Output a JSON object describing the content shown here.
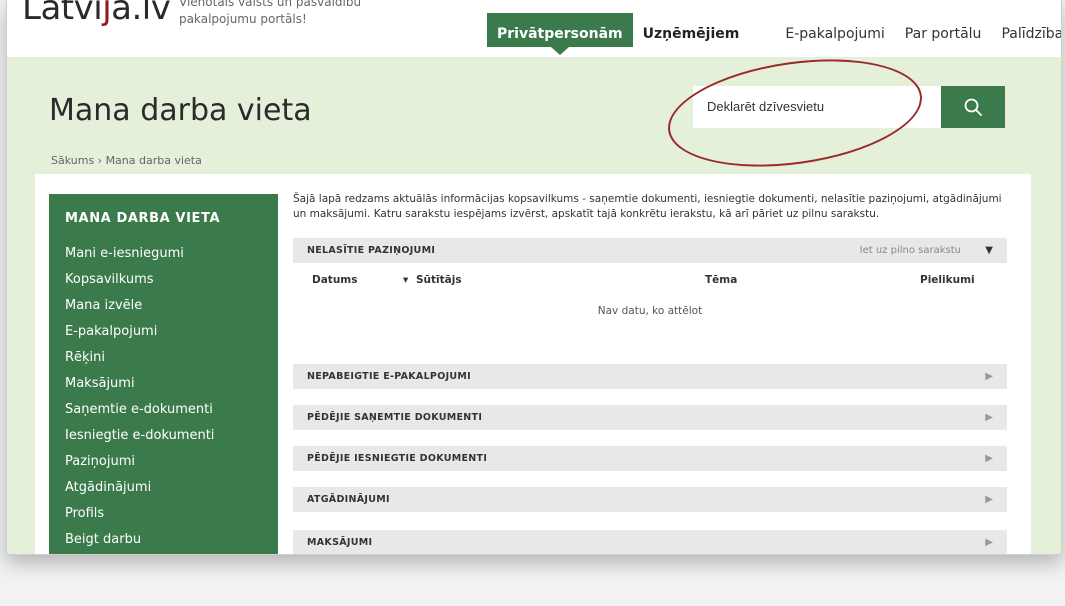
{
  "brand": {
    "logo_text_a": "Latvi",
    "logo_text_b": "a.lv",
    "tagline": "Vienotais valsts un pašvaldību pakalpojumu portāls!"
  },
  "nav": {
    "items": [
      {
        "label": "Privātpersonām"
      },
      {
        "label": "Uzņēmējiem"
      },
      {
        "label": "E-pakalpojumi"
      },
      {
        "label": "Par portālu"
      },
      {
        "label": "Palīdzība"
      }
    ]
  },
  "page": {
    "title": "Mana darba vieta",
    "breadcrumb": "Sākums › Mana darba vieta"
  },
  "search": {
    "value": "Deklarēt dzīvesvietu"
  },
  "sidebar": {
    "title": "MANA DARBA VIETA",
    "items": [
      {
        "label": "Mani e-iesniegumi"
      },
      {
        "label": "Kopsavilkums"
      },
      {
        "label": "Mana izvēle"
      },
      {
        "label": "E-pakalpojumi"
      },
      {
        "label": "Rēķini"
      },
      {
        "label": "Maksājumi"
      },
      {
        "label": "Saņemtie e-dokumenti"
      },
      {
        "label": "Iesniegtie e-dokumenti"
      },
      {
        "label": "Paziņojumi"
      },
      {
        "label": "Atgādinājumi"
      },
      {
        "label": "Profils"
      },
      {
        "label": "Beigt darbu"
      }
    ]
  },
  "main": {
    "intro": "Šajā lapā redzams aktuālās informācijas kopsavilkums - saņemtie dokumenti, iesniegtie dokumenti, nelasītie paziņojumi, atgādinājumi un maksājumi. Katru sarakstu iespējams izvērst, apskatīt tajā konkrētu ierakstu, kā arī pāriet uz pilnu sarakstu.",
    "sections": [
      {
        "label": "NELASĪTIE PAZIŅOJUMI",
        "link": "Iet uz pilno sarakstu",
        "arrow": "▼"
      },
      {
        "label": "NEPABEIGTIE E-PAKALPOJUMI",
        "arrow": "▶"
      },
      {
        "label": "PĒDĒJIE SAŅEMTIE DOKUMENTI",
        "arrow": "▶"
      },
      {
        "label": "PĒDĒJIE IESNIEGTIE DOKUMENTI",
        "arrow": "▶"
      },
      {
        "label": "ATGĀDINĀJUMI",
        "arrow": "▶"
      },
      {
        "label": "MAKSĀJUMI",
        "arrow": "▶"
      }
    ],
    "table": {
      "columns": [
        "Datums",
        "Sūtītājs",
        "Tēma",
        "Pielikumi"
      ],
      "sort_marker": "▾",
      "empty": "Nav datu, ko attēlot"
    }
  },
  "colors": {
    "brand_green": "#3b7a4a",
    "hero_bg": "#e4f0d9",
    "logo_red": "#8d1a1e",
    "highlight_ring": "#9a2a2a"
  },
  "icons": {
    "search": "search-icon",
    "expand": "caret-down-icon",
    "collapsed": "caret-right-icon"
  }
}
